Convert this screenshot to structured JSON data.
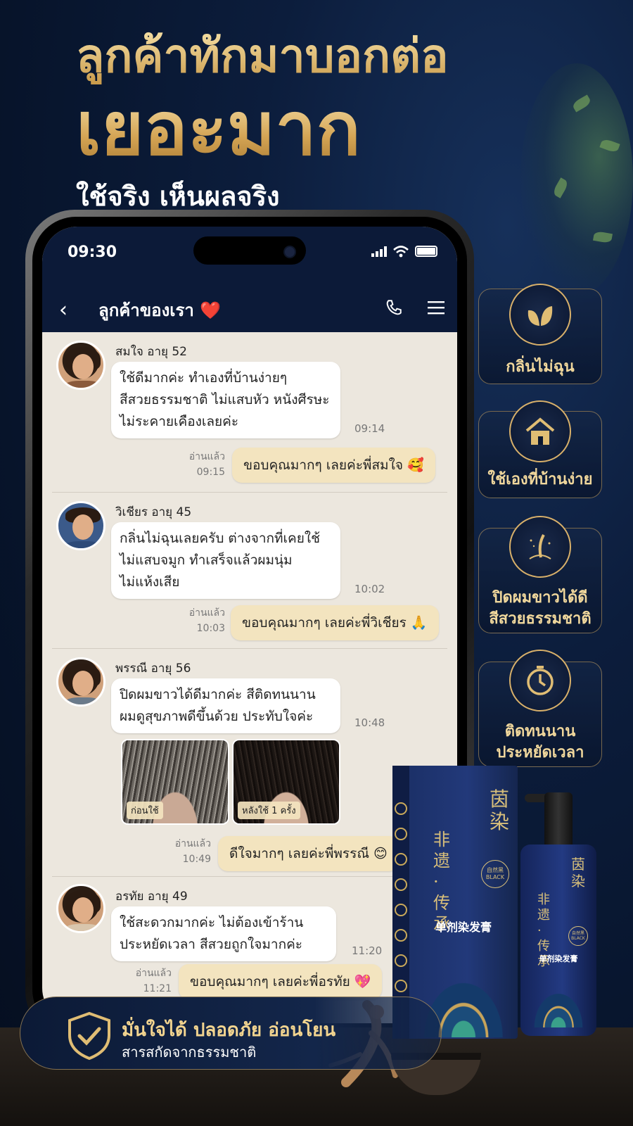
{
  "headline": {
    "line1": "ลูกค้าทักมาบอกต่อ",
    "line2": "เยอะมาก",
    "line3": "ใช้จริง เห็นผลจริง"
  },
  "phone": {
    "time": "09:30",
    "chat_title": "ลูกค้าของเรา ❤️",
    "icons": [
      "back-chevron-icon",
      "phone-icon",
      "menu-icon",
      "signal-icon",
      "wifi-icon",
      "battery-icon"
    ]
  },
  "messages": [
    {
      "name": "สมใจ  อายุ 52",
      "lines": [
        "ใช้ดีมากค่ะ ทำเองที่บ้านง่ายๆ",
        "สีสวยธรรมชาติ ไม่แสบหัว หนังศีรษะ",
        "ไม่ระคายเคืองเลยค่ะ"
      ],
      "time": "09:14",
      "read_label": "อ่านแล้ว",
      "reply_time": "09:15",
      "reply": "ขอบคุณมากๆ เลยค่ะพี่สมใจ 🥰"
    },
    {
      "name": "วิเชียร  อายุ 45",
      "lines": [
        "กลิ่นไม่ฉุนเลยครับ ต่างจากที่เคยใช้",
        "ไม่แสบจมูก ทำเสร็จแล้วผมนุ่ม",
        "ไม่แห้งเสีย"
      ],
      "time": "10:02",
      "read_label": "อ่านแล้ว",
      "reply_time": "10:03",
      "reply": "ขอบคุณมากๆ เลยค่ะพี่วิเชียร 🙏"
    },
    {
      "name": "พรรณี  อายุ 56",
      "lines": [
        "ปิดผมขาวได้ดีมากค่ะ สีติดทนนาน",
        "ผมดูสุขภาพดีขึ้นด้วย ประทับใจค่ะ"
      ],
      "time": "10:48",
      "photo_before": "ก่อนใช้",
      "photo_after": "หลังใช้ 1 ครั้ง",
      "read_label": "อ่านแล้ว",
      "reply_time": "10:49",
      "reply": "ดีใจมากๆ เลยค่ะพี่พรรณี 😊"
    },
    {
      "name": "อรทัย  อายุ 49",
      "lines": [
        "ใช้สะดวกมากค่ะ ไม่ต้องเข้าร้าน",
        "ประหยัดเวลา สีสวยถูกใจมากค่ะ"
      ],
      "time": "11:20",
      "read_label": "อ่านแล้ว",
      "reply_time": "11:21",
      "reply": "ขอบคุณมากๆ เลยค่ะพี่อรทัย 💖"
    }
  ],
  "features": [
    {
      "icon": "leaf-icon",
      "lines": [
        "กลิ่นไม่ฉุน"
      ]
    },
    {
      "icon": "house-icon",
      "lines": [
        "ใช้เองที่บ้านง่าย"
      ]
    },
    {
      "icon": "hair-strand-icon",
      "lines": [
        "ปิดผมขาวได้ดี",
        "สีสวยธรรมชาติ"
      ]
    },
    {
      "icon": "clock-icon",
      "lines": [
        "ติดทนนาน",
        "ประหยัดเวลา"
      ]
    }
  ],
  "banner": {
    "icon": "shield-check-icon",
    "title": "มั่นใจได้ ปลอดภัย อ่อนโยน",
    "subtitle": "สารสกัดจากธรรมชาติ"
  },
  "product": {
    "brand": "茵染",
    "series": "非遗·传承",
    "name": "单剂染发膏",
    "badge": "自然黑 BLACK"
  },
  "colors": {
    "gold": "#e3c27a",
    "navy": "#0c1a38",
    "bubble_out": "#f3e4bf"
  }
}
